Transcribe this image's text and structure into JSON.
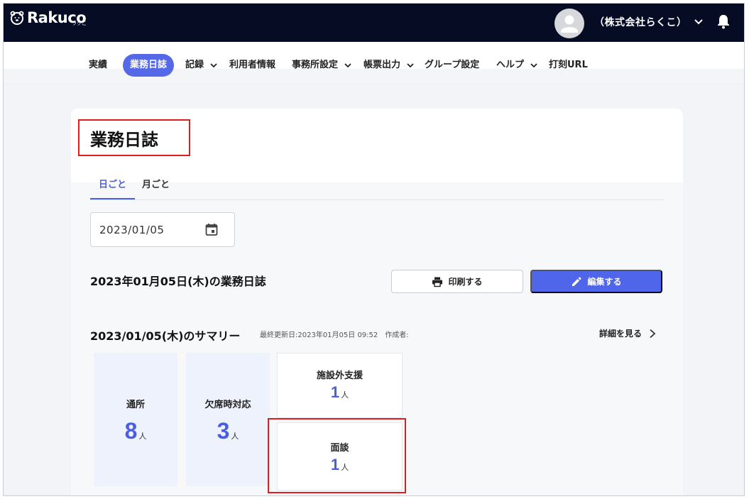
{
  "header": {
    "logo_text": "Rakuco",
    "logo_sub": "ラクこ",
    "company_name": "（株式会社らくこ）"
  },
  "nav": {
    "items": [
      {
        "label": "実績"
      },
      {
        "label": "業務日誌",
        "active": true
      },
      {
        "label": "記録",
        "has_dropdown": true
      },
      {
        "label": "利用者情報"
      },
      {
        "label": "事務所設定",
        "has_dropdown": true
      },
      {
        "label": "帳票出力",
        "has_dropdown": true
      },
      {
        "label": "グループ設定"
      },
      {
        "label": "ヘルプ",
        "has_dropdown": true
      },
      {
        "label": "打刻URL"
      }
    ]
  },
  "page": {
    "title": "業務日誌",
    "tabs": [
      {
        "label": "日ごと",
        "active": true
      },
      {
        "label": "月ごと"
      }
    ],
    "date_value": "2023/01/05",
    "journal_title": "2023年01月05日(木)の業務日誌",
    "print_button": "印刷する",
    "edit_button": "編集する"
  },
  "summary": {
    "title": "2023/01/05(木)のサマリー",
    "meta": "最終更新日:2023年01月05日 09:52　作成者:",
    "details_link": "詳細を見る",
    "stats": [
      {
        "label": "通所",
        "value": "8",
        "unit": "人"
      },
      {
        "label": "欠席時対応",
        "value": "3",
        "unit": "人"
      },
      {
        "label": "施設外支援",
        "value": "1",
        "unit": "人"
      },
      {
        "label": "面談",
        "value": "1",
        "unit": "人"
      }
    ]
  },
  "colors": {
    "topbar": "#050c24",
    "accent": "#4f66ea",
    "highlight": "#e01e1e"
  }
}
